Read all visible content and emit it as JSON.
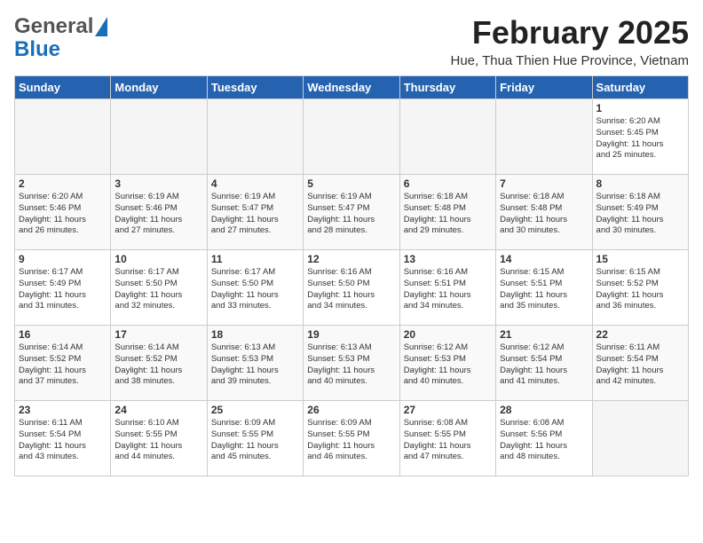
{
  "header": {
    "logo_general": "General",
    "logo_blue": "Blue",
    "month": "February 2025",
    "location": "Hue, Thua Thien Hue Province, Vietnam"
  },
  "days_of_week": [
    "Sunday",
    "Monday",
    "Tuesday",
    "Wednesday",
    "Thursday",
    "Friday",
    "Saturday"
  ],
  "weeks": [
    [
      {
        "day": "",
        "empty": true
      },
      {
        "day": "",
        "empty": true
      },
      {
        "day": "",
        "empty": true
      },
      {
        "day": "",
        "empty": true
      },
      {
        "day": "",
        "empty": true
      },
      {
        "day": "",
        "empty": true
      },
      {
        "day": "1",
        "empty": false,
        "text": "Sunrise: 6:20 AM\nSunset: 5:45 PM\nDaylight: 11 hours\nand 25 minutes."
      }
    ],
    [
      {
        "day": "2",
        "empty": false,
        "text": "Sunrise: 6:20 AM\nSunset: 5:46 PM\nDaylight: 11 hours\nand 26 minutes."
      },
      {
        "day": "3",
        "empty": false,
        "text": "Sunrise: 6:19 AM\nSunset: 5:46 PM\nDaylight: 11 hours\nand 27 minutes."
      },
      {
        "day": "4",
        "empty": false,
        "text": "Sunrise: 6:19 AM\nSunset: 5:47 PM\nDaylight: 11 hours\nand 27 minutes."
      },
      {
        "day": "5",
        "empty": false,
        "text": "Sunrise: 6:19 AM\nSunset: 5:47 PM\nDaylight: 11 hours\nand 28 minutes."
      },
      {
        "day": "6",
        "empty": false,
        "text": "Sunrise: 6:18 AM\nSunset: 5:48 PM\nDaylight: 11 hours\nand 29 minutes."
      },
      {
        "day": "7",
        "empty": false,
        "text": "Sunrise: 6:18 AM\nSunset: 5:48 PM\nDaylight: 11 hours\nand 30 minutes."
      },
      {
        "day": "8",
        "empty": false,
        "text": "Sunrise: 6:18 AM\nSunset: 5:49 PM\nDaylight: 11 hours\nand 30 minutes."
      }
    ],
    [
      {
        "day": "9",
        "empty": false,
        "text": "Sunrise: 6:17 AM\nSunset: 5:49 PM\nDaylight: 11 hours\nand 31 minutes."
      },
      {
        "day": "10",
        "empty": false,
        "text": "Sunrise: 6:17 AM\nSunset: 5:50 PM\nDaylight: 11 hours\nand 32 minutes."
      },
      {
        "day": "11",
        "empty": false,
        "text": "Sunrise: 6:17 AM\nSunset: 5:50 PM\nDaylight: 11 hours\nand 33 minutes."
      },
      {
        "day": "12",
        "empty": false,
        "text": "Sunrise: 6:16 AM\nSunset: 5:50 PM\nDaylight: 11 hours\nand 34 minutes."
      },
      {
        "day": "13",
        "empty": false,
        "text": "Sunrise: 6:16 AM\nSunset: 5:51 PM\nDaylight: 11 hours\nand 34 minutes."
      },
      {
        "day": "14",
        "empty": false,
        "text": "Sunrise: 6:15 AM\nSunset: 5:51 PM\nDaylight: 11 hours\nand 35 minutes."
      },
      {
        "day": "15",
        "empty": false,
        "text": "Sunrise: 6:15 AM\nSunset: 5:52 PM\nDaylight: 11 hours\nand 36 minutes."
      }
    ],
    [
      {
        "day": "16",
        "empty": false,
        "text": "Sunrise: 6:14 AM\nSunset: 5:52 PM\nDaylight: 11 hours\nand 37 minutes."
      },
      {
        "day": "17",
        "empty": false,
        "text": "Sunrise: 6:14 AM\nSunset: 5:52 PM\nDaylight: 11 hours\nand 38 minutes."
      },
      {
        "day": "18",
        "empty": false,
        "text": "Sunrise: 6:13 AM\nSunset: 5:53 PM\nDaylight: 11 hours\nand 39 minutes."
      },
      {
        "day": "19",
        "empty": false,
        "text": "Sunrise: 6:13 AM\nSunset: 5:53 PM\nDaylight: 11 hours\nand 40 minutes."
      },
      {
        "day": "20",
        "empty": false,
        "text": "Sunrise: 6:12 AM\nSunset: 5:53 PM\nDaylight: 11 hours\nand 40 minutes."
      },
      {
        "day": "21",
        "empty": false,
        "text": "Sunrise: 6:12 AM\nSunset: 5:54 PM\nDaylight: 11 hours\nand 41 minutes."
      },
      {
        "day": "22",
        "empty": false,
        "text": "Sunrise: 6:11 AM\nSunset: 5:54 PM\nDaylight: 11 hours\nand 42 minutes."
      }
    ],
    [
      {
        "day": "23",
        "empty": false,
        "text": "Sunrise: 6:11 AM\nSunset: 5:54 PM\nDaylight: 11 hours\nand 43 minutes."
      },
      {
        "day": "24",
        "empty": false,
        "text": "Sunrise: 6:10 AM\nSunset: 5:55 PM\nDaylight: 11 hours\nand 44 minutes."
      },
      {
        "day": "25",
        "empty": false,
        "text": "Sunrise: 6:09 AM\nSunset: 5:55 PM\nDaylight: 11 hours\nand 45 minutes."
      },
      {
        "day": "26",
        "empty": false,
        "text": "Sunrise: 6:09 AM\nSunset: 5:55 PM\nDaylight: 11 hours\nand 46 minutes."
      },
      {
        "day": "27",
        "empty": false,
        "text": "Sunrise: 6:08 AM\nSunset: 5:55 PM\nDaylight: 11 hours\nand 47 minutes."
      },
      {
        "day": "28",
        "empty": false,
        "text": "Sunrise: 6:08 AM\nSunset: 5:56 PM\nDaylight: 11 hours\nand 48 minutes."
      },
      {
        "day": "",
        "empty": true
      }
    ]
  ]
}
